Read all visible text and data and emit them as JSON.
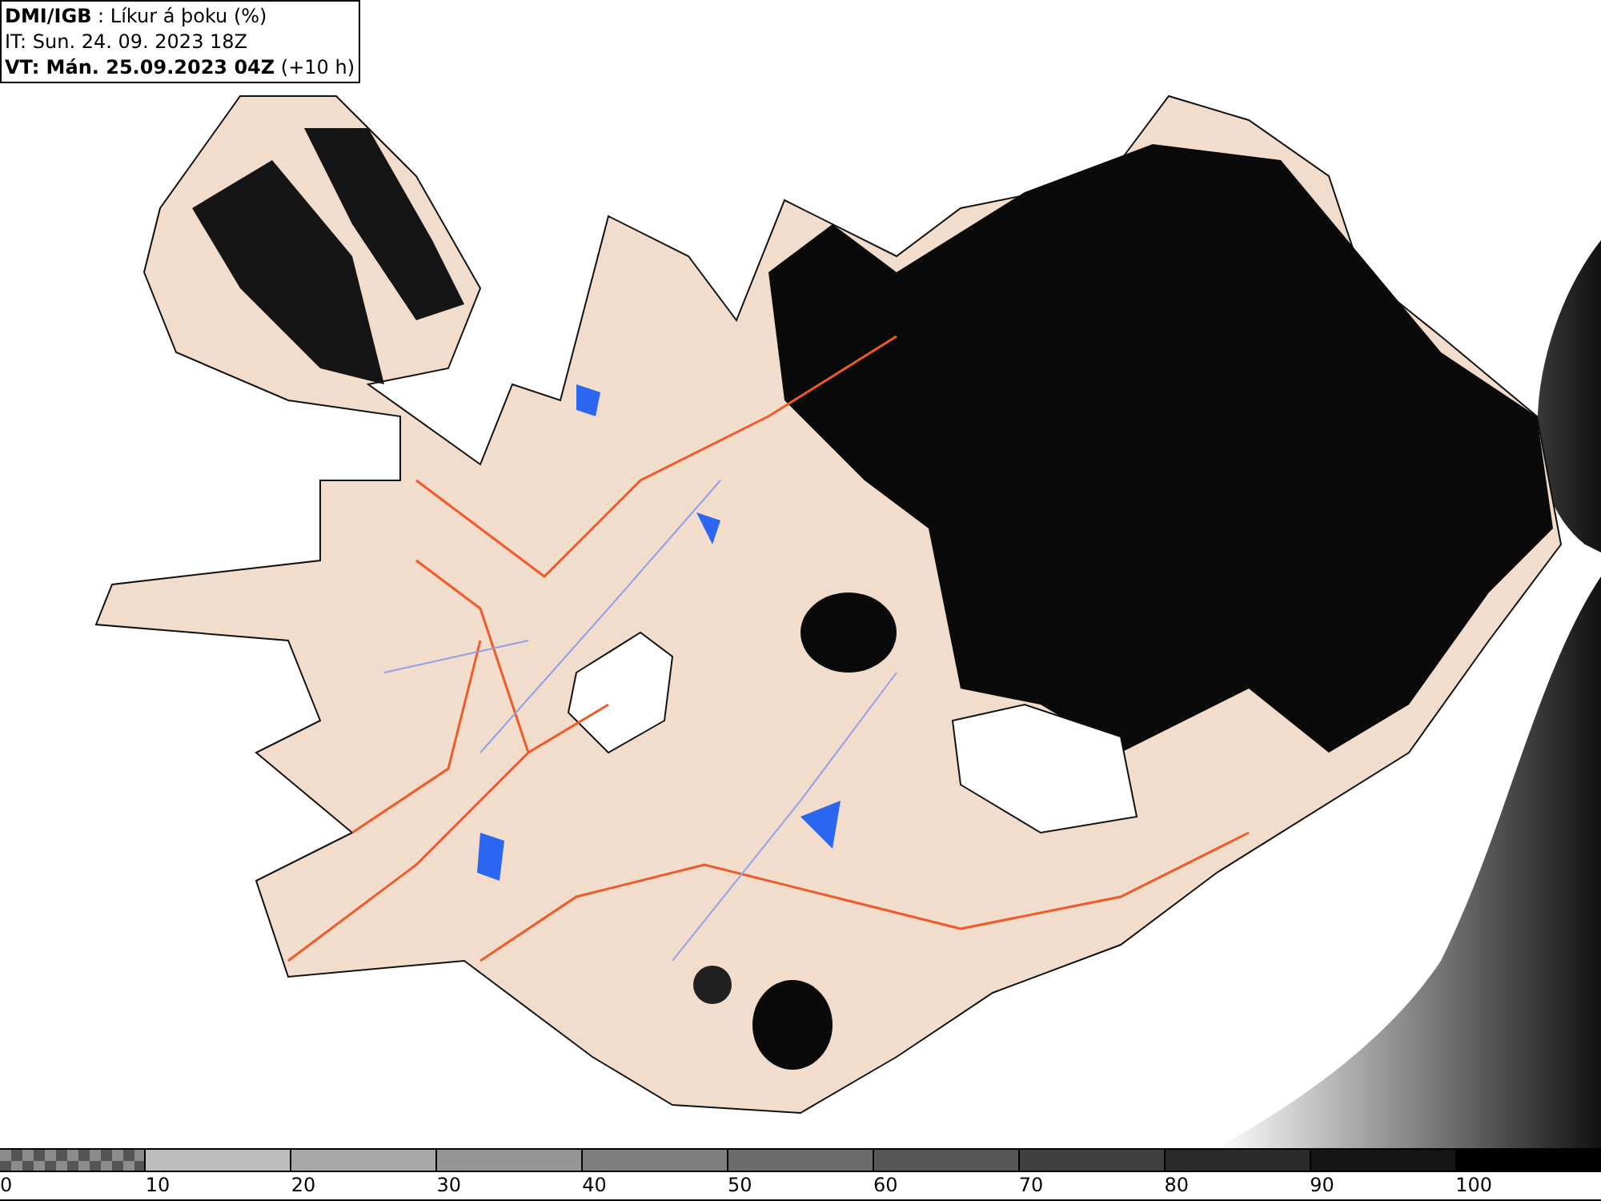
{
  "header": {
    "lines": [
      "**DMI/IGB** : Líkur á þoku (%)",
      "IT: Sun. 24. 09. 2023 18Z",
      "**VT: Mán. 25.09.2023 04Z** (+10 h)"
    ]
  },
  "legend": {
    "segments": [
      {
        "kind": "checker",
        "color": "#555555"
      },
      {
        "kind": "solid",
        "color": "#bdbdbd"
      },
      {
        "kind": "solid",
        "color": "#a8a8a8"
      },
      {
        "kind": "solid",
        "color": "#959595"
      },
      {
        "kind": "solid",
        "color": "#7f7f7f"
      },
      {
        "kind": "solid",
        "color": "#6b6b6b"
      },
      {
        "kind": "solid",
        "color": "#565656"
      },
      {
        "kind": "solid",
        "color": "#404040"
      },
      {
        "kind": "solid",
        "color": "#2a2a2a"
      },
      {
        "kind": "solid",
        "color": "#151515"
      },
      {
        "kind": "solid",
        "color": "#000000"
      }
    ],
    "labels": [
      "0",
      "10",
      "20",
      "30",
      "40",
      "50",
      "60",
      "70",
      "80",
      "90",
      "100"
    ]
  }
}
